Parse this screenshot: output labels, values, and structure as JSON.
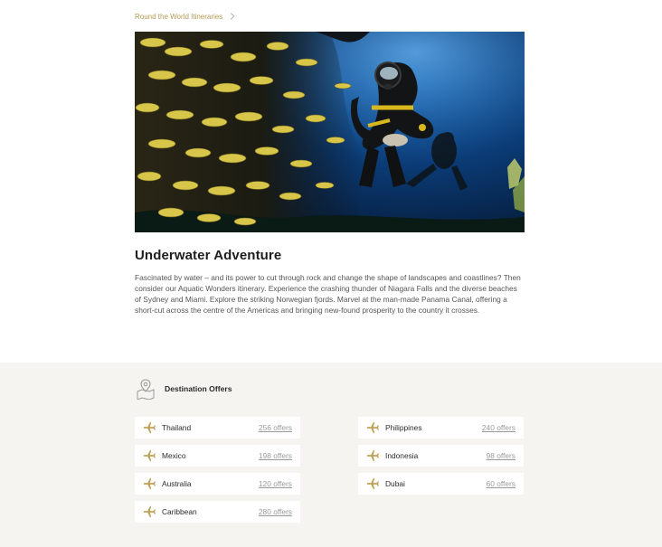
{
  "breadcrumb": {
    "label": "Round the World Itineraries"
  },
  "article": {
    "title": "Underwater Adventure",
    "description": "Fascinated by water – and its power to cut through rock and change the shape of landscapes and coastlines? Then consider our Aquatic Wonders itinerary. Experience the crashing thunder of Niagara Falls and the diverse beaches of Sydney and Miami. Explore the striking Norwegian fjords. Marvel at the man-made Panama Canal, offering a short-cut across the centre of the Americas and bringing new-found prosperity to the country it crosses."
  },
  "destinations": {
    "heading": "Destination Offers",
    "icon": "map-pin-icon",
    "items": [
      {
        "name": "Thailand",
        "offers": "256 offers"
      },
      {
        "name": "Mexico",
        "offers": "198 offers"
      },
      {
        "name": "Australia",
        "offers": "120 offers"
      },
      {
        "name": "Caribbean",
        "offers": "280 offers"
      },
      {
        "name": "Philippines",
        "offers": "240 offers"
      },
      {
        "name": "Indonesia",
        "offers": "98 offers"
      },
      {
        "name": "Dubai",
        "offers": "60 offers"
      }
    ]
  },
  "colors": {
    "accent": "#b69a52",
    "panel_bg": "#f5f4f1",
    "text": "#2b2b2b"
  }
}
